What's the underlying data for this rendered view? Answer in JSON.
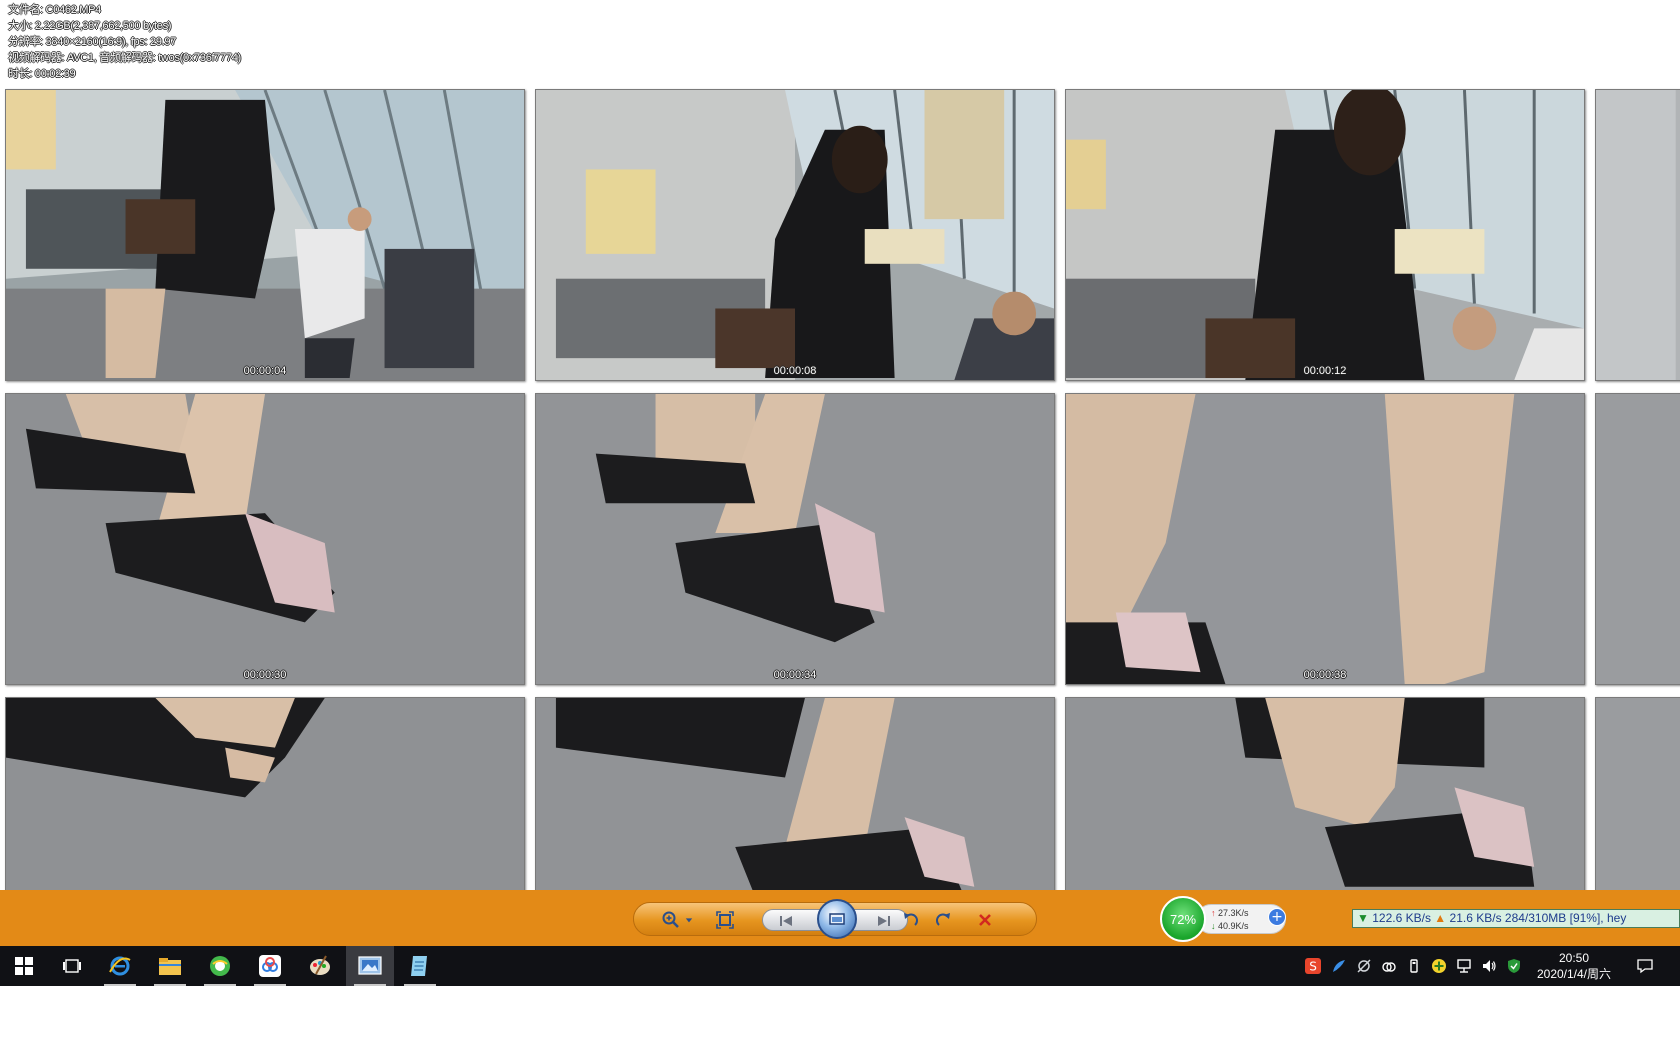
{
  "file_info": {
    "filename_line": "文件名: C0462.MP4",
    "size_line": "大小: 2.22GB(2,387,662,500 bytes)",
    "resolution_line": "分辨率: 3840×2160(16:9), fps: 29.97",
    "codec_line": "视频解码器: AVC1, 音频解码器: twos(0x736f7774)",
    "duration_line": "时长: 00:02:39"
  },
  "thumbnails": [
    {
      "timestamp": "00:00:04"
    },
    {
      "timestamp": "00:00:08"
    },
    {
      "timestamp": "00:00:12"
    },
    {
      "timestamp": ""
    },
    {
      "timestamp": "00:00:30"
    },
    {
      "timestamp": "00:00:34"
    },
    {
      "timestamp": "00:00:38"
    },
    {
      "timestamp": ""
    },
    {
      "timestamp": ""
    },
    {
      "timestamp": ""
    },
    {
      "timestamp": ""
    },
    {
      "timestamp": ""
    }
  ],
  "toolbar": {
    "buttons": [
      "zoom-dropdown-icon",
      "fit-screen-icon",
      "previous-icon",
      "view-icon",
      "next-icon",
      "rotate-left-icon",
      "rotate-right-icon",
      "delete-icon"
    ]
  },
  "system_monitor": {
    "cpu_percent": "72%",
    "upload_speed": "27.3K/s",
    "download_speed": "40.9K/s"
  },
  "download_status": {
    "down_speed": "122.6 KB/s",
    "up_speed": "21.6 KB/s",
    "progress_text": "284/310MB [91%], hey"
  },
  "taskbar": {
    "apps": [
      "start-icon",
      "task-view-icon",
      "ie-icon",
      "file-explorer-icon",
      "browser-green-icon",
      "baidu-netdisk-icon",
      "paint-icon",
      "photo-viewer-icon",
      "notepad-icon"
    ],
    "clock_time": "20:50",
    "clock_date": "2020/1/4/周六"
  },
  "colors": {
    "toolbar_orange": "#e38a17",
    "taskbar_dark": "#101115",
    "cpu_green": "#19a52b"
  }
}
